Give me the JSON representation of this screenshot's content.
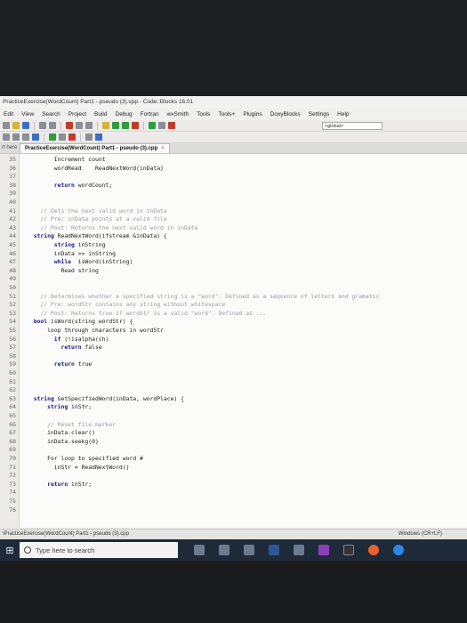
{
  "window": {
    "title": "PracticeExercise(WordCount) Part1 - pseudo (3).cpp - Code::Blocks 16.01"
  },
  "menu": [
    "Edit",
    "View",
    "Search",
    "Project",
    "Build",
    "Debug",
    "Fortran",
    "wxSmith",
    "Tools",
    "Tools+",
    "Plugins",
    "DoxyBlocks",
    "Settings",
    "Help"
  ],
  "toolbar": {
    "scope_value": "<global>"
  },
  "tabs": {
    "side_label": "rt here",
    "active_label": "PracticeExercise(WordCount) Part1 - pseudo (3).cpp",
    "close_glyph": "×"
  },
  "code_lines": [
    {
      "n": "35",
      "text": "        Increment count",
      "style": "plain"
    },
    {
      "n": "36",
      "text": "        wordRead    ReadNextWord(inData)",
      "style": "plain"
    },
    {
      "n": "37",
      "text": "",
      "style": "plain"
    },
    {
      "n": "38",
      "text": "        return wordCount;",
      "style": "kwstart"
    },
    {
      "n": "39",
      "text": "",
      "style": "plain"
    },
    {
      "n": "40",
      "text": "",
      "style": "plain"
    },
    {
      "n": "41",
      "text": "    // Gets the next valid word in inData",
      "style": "cmt"
    },
    {
      "n": "42",
      "text": "    // Pre: inData points at a valid file",
      "style": "cmt"
    },
    {
      "n": "43",
      "text": "    // Post: Returns the next valid word in inData",
      "style": "cmt"
    },
    {
      "n": "44",
      "text": "  string ReadNextWord(ifstream &inData) {",
      "style": "kwstart"
    },
    {
      "n": "45",
      "text": "        string inString",
      "style": "kwstart"
    },
    {
      "n": "46",
      "text": "        inData >> inString",
      "style": "plain"
    },
    {
      "n": "47",
      "text": "        while  isWord(inString)",
      "style": "kwstart"
    },
    {
      "n": "48",
      "text": "          Read string",
      "style": "plain"
    },
    {
      "n": "49",
      "text": "",
      "style": "plain"
    },
    {
      "n": "50",
      "text": "",
      "style": "plain"
    },
    {
      "n": "51",
      "text": "    // Determines whether a specified string is a \"word\". Defined as a sequence of letters and gramatic",
      "style": "cmt"
    },
    {
      "n": "52",
      "text": "    // Pre: wordStr contains any string without whitespace",
      "style": "cmt"
    },
    {
      "n": "53",
      "text": "    // Post: Returns true if wordStr is a valid \"word\". Defined as ...",
      "style": "cmt"
    },
    {
      "n": "54",
      "text": "  bool isWord(string wordStr) {",
      "style": "kwstart"
    },
    {
      "n": "55",
      "text": "      loop through characters in wordStr",
      "style": "plain"
    },
    {
      "n": "56",
      "text": "        if (!isalpha(ch)",
      "style": "kwstart"
    },
    {
      "n": "57",
      "text": "          return false",
      "style": "kwstart"
    },
    {
      "n": "58",
      "text": "",
      "style": "plain"
    },
    {
      "n": "59",
      "text": "        return true",
      "style": "kwstart"
    },
    {
      "n": "60",
      "text": "",
      "style": "plain"
    },
    {
      "n": "61",
      "text": "",
      "style": "plain"
    },
    {
      "n": "62",
      "text": "",
      "style": "plain"
    },
    {
      "n": "63",
      "text": "  string GetSpecifiedWord(inData, wordPlace) {",
      "style": "kwstart"
    },
    {
      "n": "64",
      "text": "      string inStr;",
      "style": "kwstart"
    },
    {
      "n": "65",
      "text": "",
      "style": "plain"
    },
    {
      "n": "66",
      "text": "      // Reset file marker",
      "style": "cmt"
    },
    {
      "n": "67",
      "text": "      inData.clear()",
      "style": "plain"
    },
    {
      "n": "68",
      "text": "      inData.seekg(0)",
      "style": "plain"
    },
    {
      "n": "69",
      "text": "",
      "style": "plain"
    },
    {
      "n": "70",
      "text": "      For loop to specified word #",
      "style": "plain"
    },
    {
      "n": "71",
      "text": "        inStr = ReadNextWord()",
      "style": "plain"
    },
    {
      "n": "72",
      "text": "",
      "style": "plain"
    },
    {
      "n": "73",
      "text": "      return inStr;",
      "style": "kwstart"
    },
    {
      "n": "74",
      "text": "",
      "style": "plain"
    },
    {
      "n": "75",
      "text": "",
      "style": "plain"
    },
    {
      "n": "76",
      "text": "",
      "style": "plain"
    }
  ],
  "status": {
    "file_path": "\\PracticeExercise(WordCount) Part1 - pseudo (3).cpp",
    "encoding": "Windows (CR+LF)"
  },
  "taskbar": {
    "search_placeholder": "Type here to search",
    "apps": [
      "file-explorer",
      "task-view",
      "steam",
      "word",
      "photos",
      "onenote",
      "nox",
      "opera",
      "edge"
    ]
  }
}
